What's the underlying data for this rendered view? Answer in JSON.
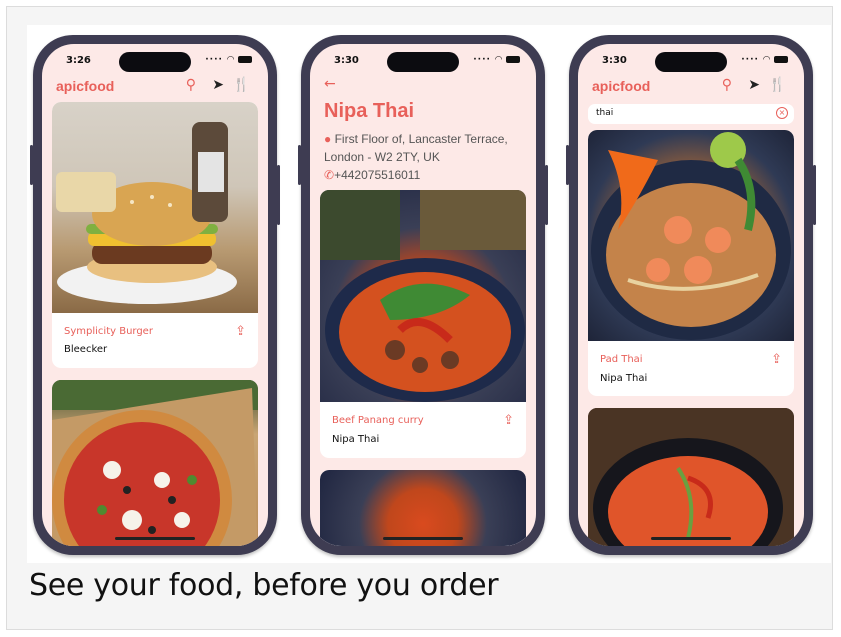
{
  "caption": "See your food, before you order",
  "brand": {
    "name": "apicfood",
    "accent": "#e8605a"
  },
  "phone1": {
    "time": "3:26",
    "cards": [
      {
        "name": "Symplicity Burger",
        "restaurant": "Bleecker"
      }
    ]
  },
  "phone2": {
    "time": "3:30",
    "restaurant": {
      "name": "Nipa Thai",
      "address": "First Floor of, Lancaster Terrace, London - W2 2TY, UK",
      "phone": "+442075516011"
    },
    "cards": [
      {
        "name": "Beef Panang curry",
        "restaurant": "Nipa Thai"
      }
    ]
  },
  "phone3": {
    "time": "3:30",
    "search_value": "thai",
    "cards": [
      {
        "name": "Pad Thai",
        "restaurant": "Nipa Thai"
      }
    ]
  },
  "icons": {
    "search": "search-icon",
    "navigate": "location-arrow-icon",
    "menu": "fork-knife-icon",
    "share": "share-icon",
    "back": "back-arrow-icon",
    "pin": "map-pin-icon",
    "call": "phone-icon",
    "clear": "clear-icon"
  }
}
